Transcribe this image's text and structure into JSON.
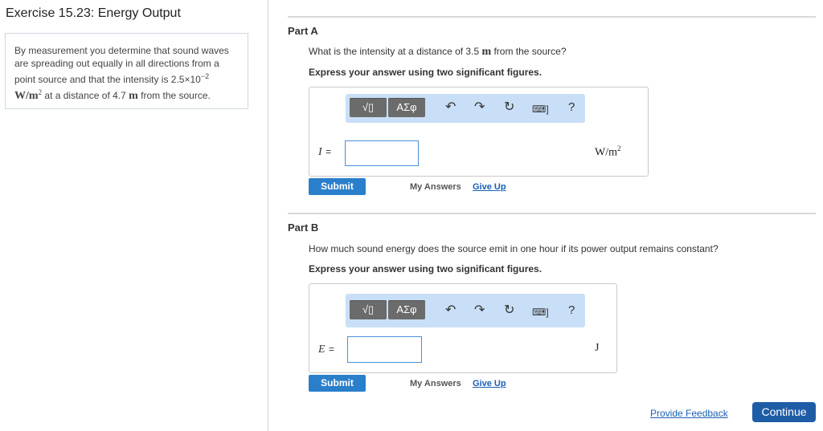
{
  "exercise": {
    "title": "Exercise 15.23: Energy Output",
    "problem": {
      "line1": "By measurement you determine that sound waves",
      "line2": "are spreading out equally in all directions from a",
      "line3": "point source and that the intensity is 2.5×10",
      "line3_exp": "−2",
      "line4_unit": "W/m",
      "line4_unit_exp": "2",
      "line4_mid": " at a distance of 4.7 ",
      "line4_m": "m",
      "line4_end": " from the source."
    }
  },
  "part_a": {
    "label": "Part A",
    "question_pre": "What is the intensity at a distance of 3.5 ",
    "question_m": "m",
    "question_post": " from the source?",
    "instruction": "Express your answer using two significant figures.",
    "variable": "I",
    "equals": "=",
    "input_value": "",
    "unit": "W/m",
    "unit_exp": "2",
    "submit": "Submit",
    "my_answers": "My Answers",
    "give_up": "Give Up"
  },
  "part_b": {
    "label": "Part B",
    "question": "How much sound energy does the source emit in one hour if its power output remains constant?",
    "instruction": "Express your answer using two significant figures.",
    "variable": "E",
    "equals": "=",
    "input_value": "",
    "unit": "J",
    "submit": "Submit",
    "my_answers": "My Answers",
    "give_up": "Give Up"
  },
  "toolbar": {
    "template_label": "√▯",
    "symbols_label": "ΑΣφ",
    "help_label": "?",
    "icons": [
      "templates-icon",
      "greek-symbols-icon",
      "undo-icon",
      "redo-icon",
      "reset-icon",
      "keyboard-icon",
      "help-icon"
    ]
  },
  "footer": {
    "feedback": "Provide Feedback",
    "continue": "Continue"
  }
}
